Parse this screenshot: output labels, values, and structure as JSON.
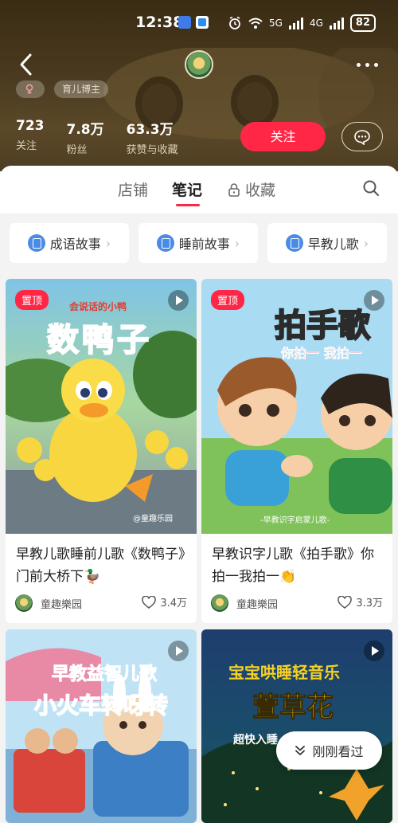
{
  "status_bar": {
    "time": "12:38",
    "network_a": "5G",
    "network_b": "4G",
    "battery": "82"
  },
  "nav": {
    "back_icon": "chevron-left-icon",
    "more_icon": "more-dots-icon"
  },
  "profile": {
    "tag_b": "育儿博主",
    "stats": [
      {
        "value": "723",
        "label": "关注"
      },
      {
        "value": "7.8万",
        "label": "粉丝"
      },
      {
        "value": "63.3万",
        "label": "获赞与收藏"
      }
    ],
    "follow_label": "关注"
  },
  "tabs": {
    "store": "店铺",
    "notes": "笔记",
    "favorites": "收藏"
  },
  "categories": [
    {
      "label": "成语故事"
    },
    {
      "label": "睡前故事"
    },
    {
      "label": "早教儿歌"
    }
  ],
  "cards": [
    {
      "pinned": "置顶",
      "cover_small": "会说话的小鸭",
      "cover_title": "数鸭子",
      "cover_watermark": "@童趣乐园",
      "title": "早教儿歌睡前儿歌《数鸭子》门前大桥下🦆",
      "author": "童趣樂园",
      "likes": "3.4万"
    },
    {
      "pinned": "置顶",
      "cover_title": "拍手歌",
      "cover_sub": "你拍一 我拍一",
      "cover_watermark": "-早教识字启蒙儿歌-",
      "title": "早教识字儿歌《拍手歌》你拍一我拍一👏",
      "author": "童趣樂园",
      "likes": "3.3万"
    },
    {
      "cover_title_a": "早教益智儿歌",
      "cover_title_b": "小火车转呀转"
    },
    {
      "cover_title_a": "宝宝哄睡轻音乐",
      "cover_title_b": "萱草花",
      "cover_sub": "超快入睡"
    }
  ],
  "recent_button": "刚刚看过",
  "colors": {
    "accent": "#ff2745",
    "header_brown": "#4a3a1f",
    "category_icon": "#4a8be6"
  }
}
